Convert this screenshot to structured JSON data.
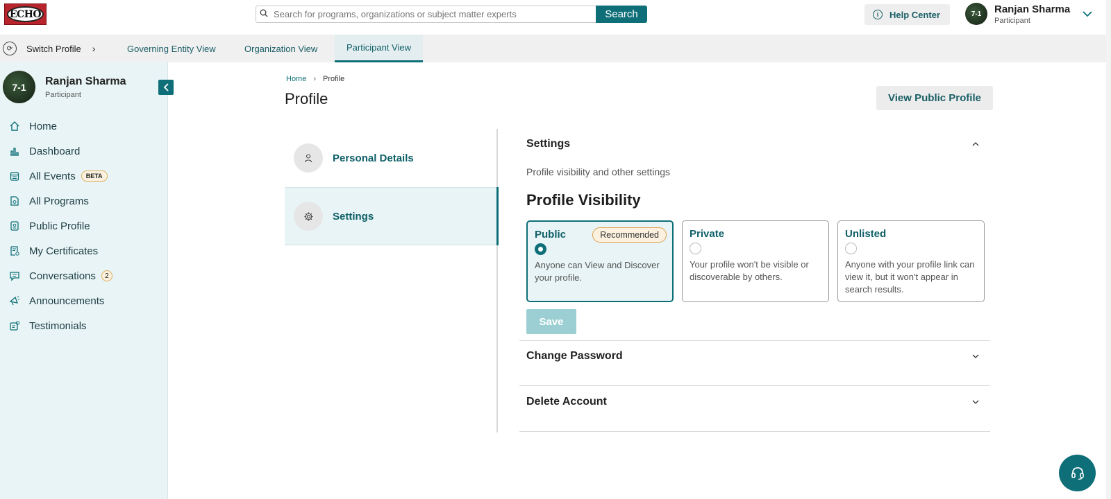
{
  "topbar": {
    "logo_text": "ECHO",
    "search_placeholder": "Search for programs, organizations or subject matter experts",
    "search_button": "Search",
    "help_center": "Help Center",
    "user_name": "Ranjan Sharma",
    "user_role": "Participant"
  },
  "subnav": {
    "switch_profile": "Switch Profile",
    "tabs": [
      "Governing Entity View",
      "Organization View",
      "Participant View"
    ],
    "active_tab": "Participant View"
  },
  "sidebar": {
    "user_name": "Ranjan Sharma",
    "user_role": "Participant",
    "items": [
      {
        "label": "Home",
        "icon": "home-icon"
      },
      {
        "label": "Dashboard",
        "icon": "chart-icon"
      },
      {
        "label": "All Events",
        "icon": "calendar-icon",
        "badge": "BETA"
      },
      {
        "label": "All Programs",
        "icon": "document-icon"
      },
      {
        "label": "Public Profile",
        "icon": "id-badge-icon"
      },
      {
        "label": "My Certificates",
        "icon": "certificate-icon"
      },
      {
        "label": "Conversations",
        "icon": "chat-icon",
        "count": "2"
      },
      {
        "label": "Announcements",
        "icon": "megaphone-icon"
      },
      {
        "label": "Testimonials",
        "icon": "testimonial-icon"
      }
    ]
  },
  "breadcrumb": {
    "home": "Home",
    "current": "Profile"
  },
  "page": {
    "title": "Profile",
    "view_public_profile": "View Public Profile"
  },
  "left_menu": {
    "items": [
      {
        "label": "Personal Details",
        "icon": "person-icon"
      },
      {
        "label": "Settings",
        "icon": "gear-icon"
      }
    ],
    "active": "Settings"
  },
  "settings": {
    "heading": "Settings",
    "subtitle": "Profile visibility and other settings",
    "visibility_title": "Profile Visibility",
    "options": [
      {
        "title": "Public",
        "badge": "Recommended",
        "description": "Anyone can View and Discover your profile.",
        "selected": true
      },
      {
        "title": "Private",
        "description": "Your profile won't be visible or discoverable by others.",
        "selected": false
      },
      {
        "title": "Unlisted",
        "description": "Anyone with your profile link can view it, but it won't appear in search results.",
        "selected": false
      }
    ],
    "save_label": "Save",
    "change_password": "Change Password",
    "delete_account": "Delete Account"
  },
  "colors": {
    "accent": "#0e6f78",
    "sidebar_bg": "#e8f4f5",
    "badge_bg": "#fcf1df"
  }
}
